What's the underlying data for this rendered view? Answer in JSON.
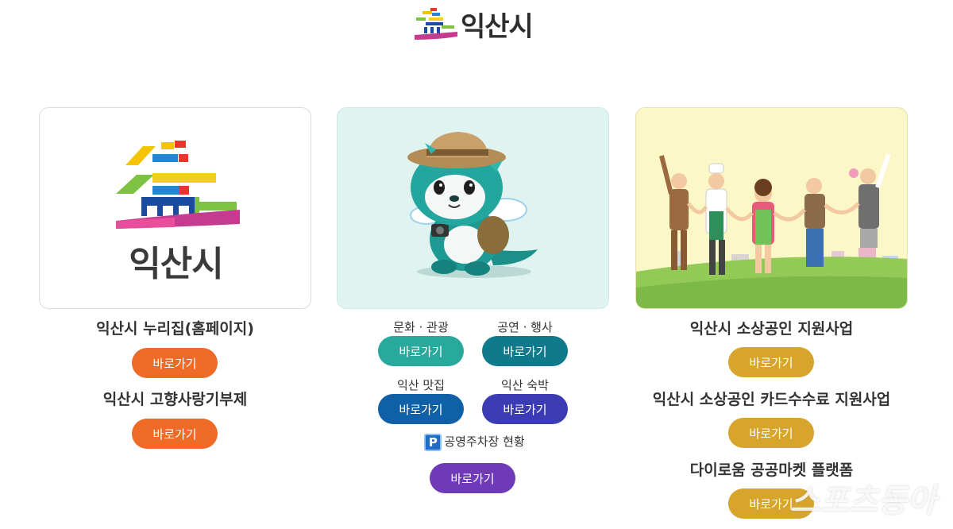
{
  "header": {
    "logo_text": "익산시"
  },
  "card1": {
    "logo_text": "익산시",
    "title_1": "익산시 누리집(홈페이지)",
    "button_1": "바로가기",
    "title_2": "익산시 고향사랑기부제",
    "button_2": "바로가기"
  },
  "card2": {
    "items": [
      {
        "label": "문화 · 관광",
        "button": "바로가기"
      },
      {
        "label": "공연 · 행사",
        "button": "바로가기"
      },
      {
        "label": "익산 맛집",
        "button": "바로가기"
      },
      {
        "label": "익산 숙박",
        "button": "바로가기"
      }
    ],
    "parking_icon": "P",
    "parking_label": "공영주차장 현황",
    "parking_button": "바로가기"
  },
  "card3": {
    "title_1": "익산시 소상공인 지원사업",
    "button_1": "바로가기",
    "title_2": "익산시 소상공인 카드수수료 지원사업",
    "button_2": "바로가기",
    "title_3": "다이로움 공공마켓 플랫폼",
    "button_3": "바로가기"
  },
  "watermark": "스포츠동아",
  "colors": {
    "orange": "#ef6a26",
    "gold": "#d7a42c",
    "teal": "#29a99c",
    "deep_teal": "#0e7a8c",
    "blue": "#1060a8",
    "indigo": "#3b3bb3",
    "purple": "#6f3ab8"
  },
  "icons": [
    "iksan-city-logo",
    "mascot-dragon-illustration",
    "small-business-people-illustration",
    "parking-icon"
  ]
}
